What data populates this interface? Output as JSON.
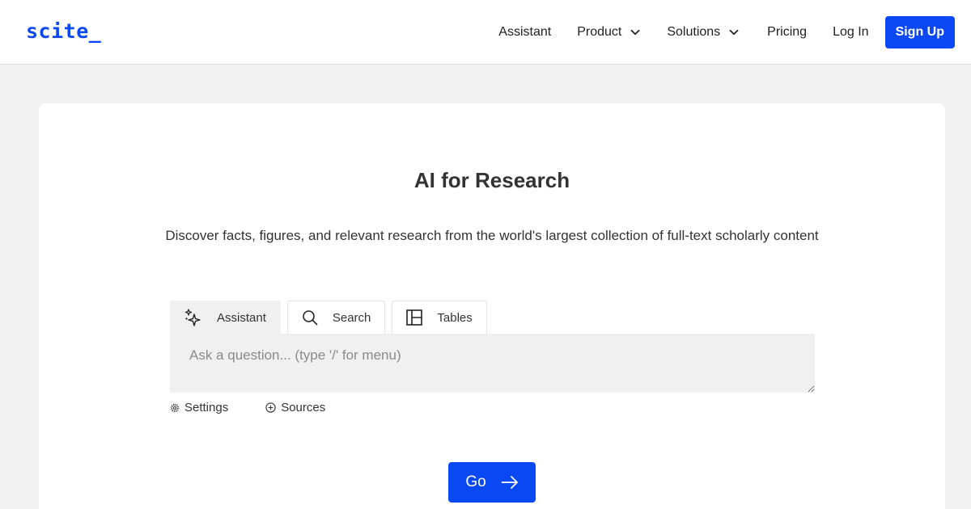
{
  "header": {
    "logo": "scite_",
    "nav": {
      "assistant": "Assistant",
      "product": "Product",
      "solutions": "Solutions",
      "pricing": "Pricing",
      "login": "Log In",
      "signup": "Sign Up"
    }
  },
  "hero": {
    "title": "AI for Research",
    "subtitle": "Discover facts, figures, and relevant research from the world's largest collection of full-text scholarly content"
  },
  "tabs": [
    {
      "label": "Assistant",
      "icon": "sparkles-icon",
      "active": true
    },
    {
      "label": "Search",
      "icon": "search-icon",
      "active": false
    },
    {
      "label": "Tables",
      "icon": "table-layout-icon",
      "active": false
    }
  ],
  "query": {
    "placeholder": "Ask a question... (type '/' for menu)",
    "value": ""
  },
  "options": {
    "settings": "Settings",
    "sources": "Sources"
  },
  "go_button": {
    "label": "Go",
    "icon": "arrow-right-icon"
  },
  "colors": {
    "brand": "#0a48f4",
    "background": "#f2f2f2",
    "card": "#ffffff",
    "input_bg": "#f0f0f0"
  }
}
